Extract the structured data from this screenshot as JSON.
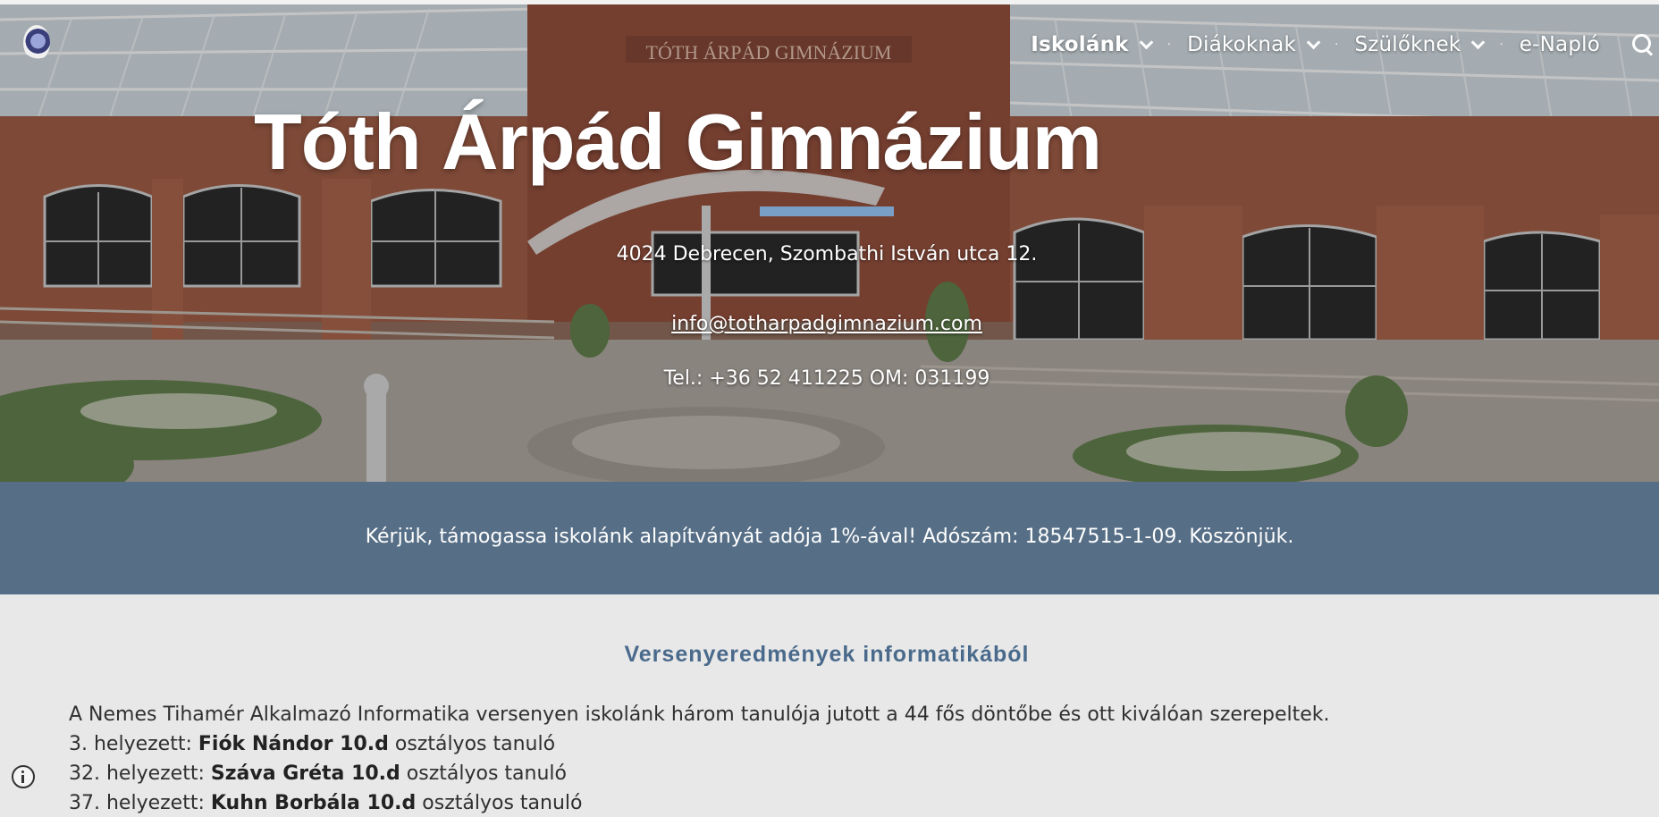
{
  "nav": {
    "items": [
      {
        "label": "Iskolánk",
        "dropdown": true,
        "active": true
      },
      {
        "label": "Diákoknak",
        "dropdown": true,
        "active": false
      },
      {
        "label": "Szülőknek",
        "dropdown": true,
        "active": false
      },
      {
        "label": "e-Napló",
        "dropdown": false,
        "active": false
      }
    ],
    "search_icon": "search-icon"
  },
  "building_sign": "TÓTH ÁRPÁD GIMNÁZIUM",
  "hero": {
    "title": "Tóth Árpád Gimnázium",
    "address": "4024 Debrecen, Szombathi István utca 12.",
    "email": "info@totharpadgimnazium.com",
    "tel_om": "Tel.: +36 52 411225   OM: 031199",
    "accent_color": "#7a9fc6"
  },
  "banner": {
    "text": "Kérjük, támogassa iskolánk alapítványát adója 1%-ával! Adószám: 18547515-1-09. Köszönjük.",
    "color": "#566e86"
  },
  "section": {
    "title": "Versenyeredmények informatikából",
    "intro": "A Nemes Tihamér Alkalmazó Informatika versenyen iskolánk három tanulója jutott a 44 fős döntőbe és ott kiválóan szerepeltek.",
    "results": [
      {
        "place": "3. helyezett: ",
        "name": "Fiók Nándor 10.d",
        "suffix": " osztályos tanuló"
      },
      {
        "place": "32. helyezett: ",
        "name": "Száva Gréta 10.d",
        "suffix": " osztályos tanuló"
      },
      {
        "place": "37. helyezett: ",
        "name": "Kuhn Borbála 10.d",
        "suffix": " osztályos tanuló"
      }
    ]
  },
  "footer": {
    "info_icon": "info-icon"
  }
}
